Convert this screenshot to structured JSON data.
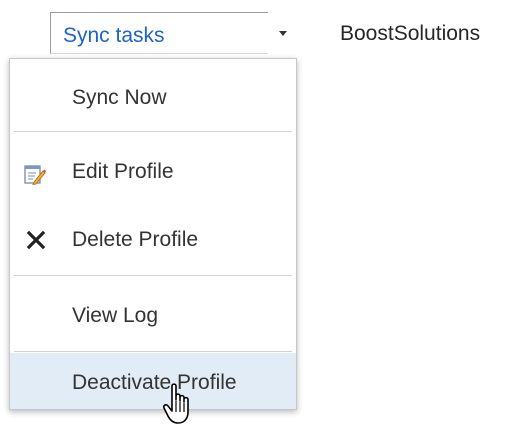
{
  "dropdown": {
    "label": "Sync tasks",
    "caret_icon": "chevron-down-icon"
  },
  "site_name": "BoostSolutions",
  "menu": {
    "items": [
      {
        "label": "Sync Now",
        "icon": null
      },
      {
        "label": "Edit Profile",
        "icon": "edit-document-icon"
      },
      {
        "label": "Delete Profile",
        "icon": "delete-x-icon"
      },
      {
        "label": "View Log",
        "icon": null
      },
      {
        "label": "Deactivate Profile",
        "icon": null,
        "hovered": true
      }
    ]
  },
  "cursor": "hand-pointer-icon",
  "colors": {
    "link_blue": "#1e64c8",
    "hover_bg": "#e1ecf7",
    "text": "#333333"
  }
}
